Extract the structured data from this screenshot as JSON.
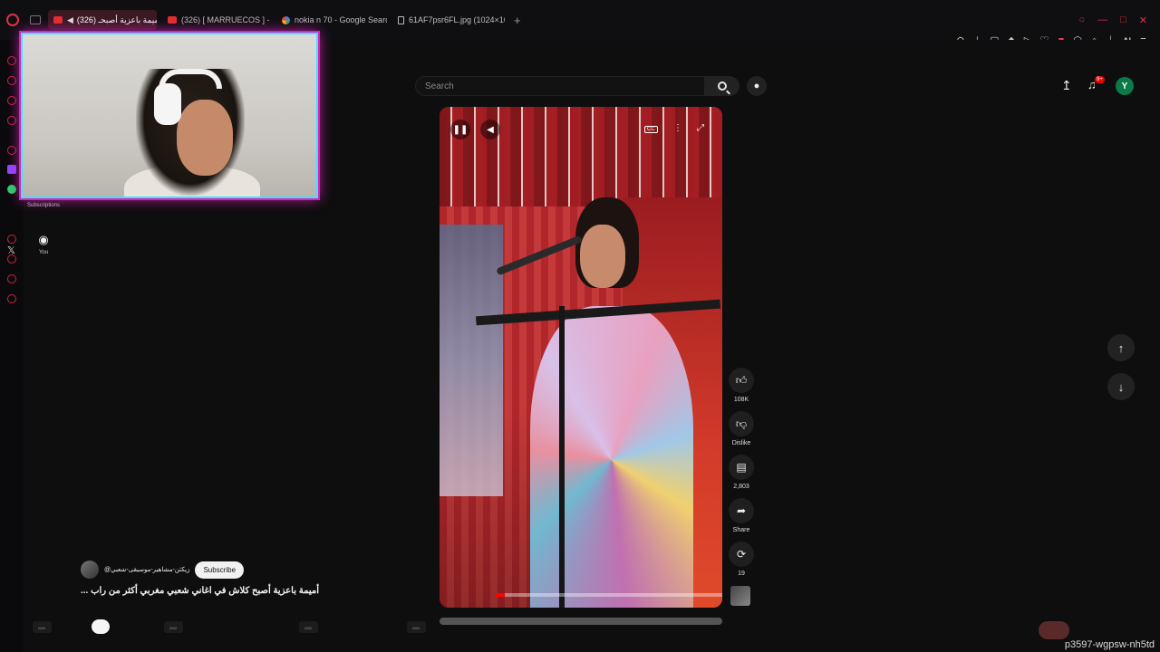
{
  "browser": {
    "tabs": [
      {
        "title": "أميمة باعزية أصبحـ (326)",
        "favicon": "youtube",
        "active": true
      },
      {
        "title": "(326) [ MARRUECOS ] - Y",
        "favicon": "youtube",
        "active": false
      },
      {
        "title": "nokia n 70 - Google Searc",
        "favicon": "google",
        "active": false
      },
      {
        "title": "61AF7psr6FL.jpg (1024×10",
        "favicon": "document",
        "active": false
      }
    ],
    "new_tab": "+",
    "toolbar_ai_label": "AI",
    "accent_color": "#e0304a"
  },
  "youtube": {
    "search_placeholder": "Search",
    "notification_badge": "9+",
    "avatar_letter": "Y",
    "nav": {
      "subscriptions": "Subscriptions",
      "you": "You"
    },
    "actions": {
      "like_count": "108K",
      "dislike_label": "Dislike",
      "comment_count": "2,803",
      "share_label": "Share",
      "remix_count": "19"
    },
    "channel_name": "@زيكثن-مشاهير-موسيقى-شعبي",
    "subscribe_label": "Subscribe",
    "video_title": "أميمة باعزية أصبح كلاش في اغاني شعبي مغربي أكثر من راب ...",
    "progress": 0.04
  },
  "overlay": {
    "stream_id": "p3597-wgpsw-nh5td"
  }
}
